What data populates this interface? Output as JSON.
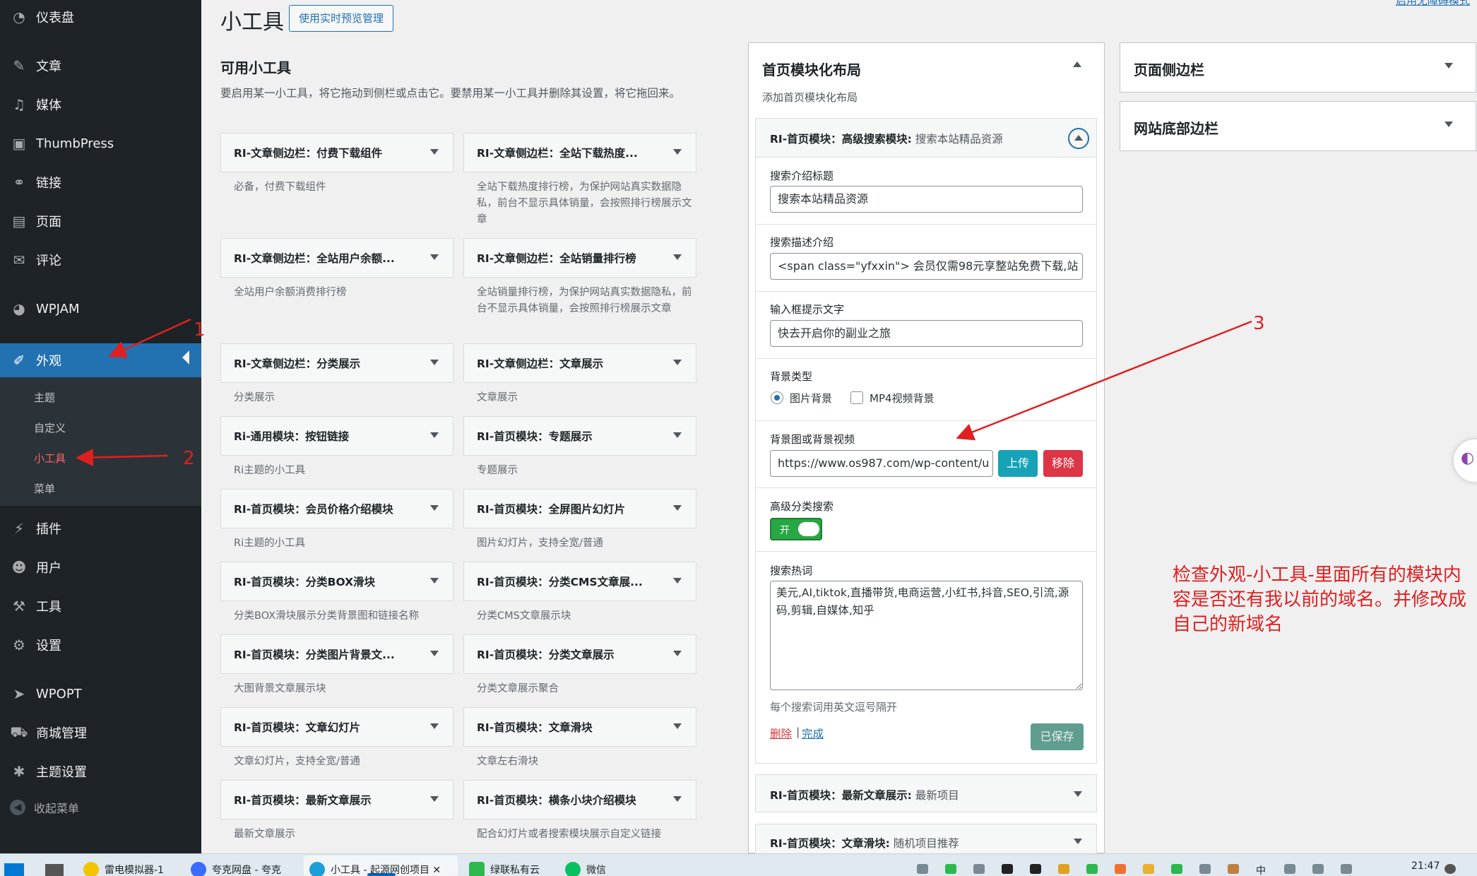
{
  "sidebar": {
    "items": [
      {
        "label": "仪表盘",
        "icon": "dashboard-icon",
        "glyph": "◔"
      },
      {
        "label": "文章",
        "icon": "pin-icon",
        "glyph": "✎"
      },
      {
        "label": "媒体",
        "icon": "media-icon",
        "glyph": "♫"
      },
      {
        "label": "ThumbPress",
        "icon": "image-icon",
        "glyph": "▣"
      },
      {
        "label": "链接",
        "icon": "link-icon",
        "glyph": "⚭"
      },
      {
        "label": "页面",
        "icon": "page-icon",
        "glyph": "▤"
      },
      {
        "label": "评论",
        "icon": "comment-icon",
        "glyph": "✉"
      },
      {
        "label": "WPJAM",
        "icon": "wpjam-icon",
        "glyph": "◕"
      },
      {
        "label": "外观",
        "icon": "brush-icon",
        "glyph": "✐"
      },
      {
        "label": "插件",
        "icon": "plugin-icon",
        "glyph": "⚡"
      },
      {
        "label": "用户",
        "icon": "user-icon",
        "glyph": "☻"
      },
      {
        "label": "工具",
        "icon": "wrench-icon",
        "glyph": "⚒"
      },
      {
        "label": "设置",
        "icon": "settings-icon",
        "glyph": "⚙"
      },
      {
        "label": "WPOPT",
        "icon": "rocket-icon",
        "glyph": "➤"
      },
      {
        "label": "商城管理",
        "icon": "cart-icon",
        "glyph": "⛟"
      },
      {
        "label": "主题设置",
        "icon": "gear-icon",
        "glyph": "✱"
      }
    ],
    "sub_items": [
      "主题",
      "自定义",
      "小工具",
      "菜单"
    ],
    "collapse_label": "收起菜单"
  },
  "header": {
    "title": "小工具",
    "live_preview_button": "使用实时预览管理",
    "top_right_link": "启用无障碍模式"
  },
  "available": {
    "title": "可用小工具",
    "description": "要启用某一小工具，将它拖动到侧栏或点击它。要禁用某一小工具并删除其设置，将它拖回来。",
    "widgets": [
      {
        "title": "RI-文章侧边栏：付费下载组件",
        "desc": "必备，付费下载组件"
      },
      {
        "title": "RI-文章侧边栏：全站下载热度...",
        "desc": "全站下载热度排行榜，为保护网站真实数据隐私，前台不显示具体销量，会按照排行榜展示文章"
      },
      {
        "title": "RI-文章侧边栏：全站用户余额...",
        "desc": "全站用户余额消费排行榜"
      },
      {
        "title": "RI-文章侧边栏：全站销量排行榜",
        "desc": "全站销量排行榜，为保护网站真实数据隐私，前台不显示具体销量，会按照排行榜展示文章"
      },
      {
        "title": "RI-文章侧边栏：分类展示",
        "desc": "分类展示"
      },
      {
        "title": "RI-文章侧边栏：文章展示",
        "desc": "文章展示"
      },
      {
        "title": "Ri-通用模块：按钮链接",
        "desc": "Ri主题的小工具"
      },
      {
        "title": "RI-首页模块：专题展示",
        "desc": "专题展示"
      },
      {
        "title": "RI-首页模块：会员价格介绍模块",
        "desc": "Ri主题的小工具"
      },
      {
        "title": "RI-首页模块：全屏图片幻灯片",
        "desc": "图片幻灯片，支持全宽/普通"
      },
      {
        "title": "RI-首页模块：分类BOX滑块",
        "desc": "分类BOX滑块展示分类背景图和链接名称"
      },
      {
        "title": "RI-首页模块：分类CMS文章展...",
        "desc": "分类CMS文章展示块"
      },
      {
        "title": "RI-首页模块：分类图片背景文...",
        "desc": "大图背景文章展示块"
      },
      {
        "title": "RI-首页模块：分类文章展示",
        "desc": "分类文章展示聚合"
      },
      {
        "title": "RI-首页模块：文章幻灯片",
        "desc": "文章幻灯片，支持全宽/普通"
      },
      {
        "title": "RI-首页模块：文章滑块",
        "desc": "文章左右滑块"
      },
      {
        "title": "RI-首页模块：最新文章展示",
        "desc": "最新文章展示"
      },
      {
        "title": "RI-首页模块：横条小块介绍模块",
        "desc": "配合幻灯片或者搜索模块展示自定义链接"
      }
    ]
  },
  "home_area": {
    "title": "首页模块化布局",
    "subtitle": "添加首页模块化布局",
    "open_widget": {
      "title": "RI-首页模块：高级搜索模块:",
      "subtitle": " 搜索本站精品资源",
      "fields": {
        "intro_title_label": "搜索介绍标题",
        "intro_title_value": "搜索本站精品资源",
        "desc_label": "搜索描述介绍",
        "desc_value": "<span class=\"yfxxin\"> 会员仅需98元享整站免费下载,站",
        "placeholder_label": "输入框提示文字",
        "placeholder_value": "快去开启你的副业之旅",
        "bg_type_label": "背景类型",
        "bg_type_options": [
          "图片背景",
          "MP4视频背景"
        ],
        "bg_media_label": "背景图或背景视频",
        "bg_media_value": "https://www.os987.com/wp-content/u",
        "upload_button": "上传",
        "remove_button": "移除",
        "adv_search_label": "高级分类搜索",
        "toggle_label": "开",
        "hot_words_label": "搜索热词",
        "hot_words_value": "美元,AI,tiktok,直播带货,电商运营,小红书,抖音,SEO,引流,源码,剪辑,自媒体,知乎",
        "hot_words_hint": "每个搜索词用英文逗号隔开"
      },
      "delete_link": "删除",
      "separator": "|",
      "done_link": "完成",
      "saved_button": "已保存"
    },
    "collapsed_widgets": [
      {
        "title": "RI-首页模块：最新文章展示:",
        "subtitle": " 最新项目"
      },
      {
        "title": "RI-首页模块：文章滑块:",
        "subtitle": " 随机项目推荐"
      }
    ]
  },
  "other_areas": [
    {
      "title": "页面侧边栏"
    },
    {
      "title": "网站底部边栏"
    }
  ],
  "annotations": {
    "num1": "1",
    "num2": "2",
    "num3": "3",
    "note": "检查外观-小工具-里面所有的模块内容是否还有我以前的域名。并修改成自己的新域名"
  },
  "taskbar": {
    "items": [
      "雷电模拟器-1",
      "夸克网盘 - 夸克",
      "小工具 - 起源网创项目 ✕",
      "绿联私有云",
      "微信"
    ],
    "time": "21:47",
    "ime": "中"
  },
  "colors": {
    "sidebar_bg": "#1d2327",
    "accent": "#2271b1",
    "annotation": "#e02020",
    "upload": "#17a2b8",
    "remove": "#dc3545",
    "toggle_on": "#28a745"
  }
}
